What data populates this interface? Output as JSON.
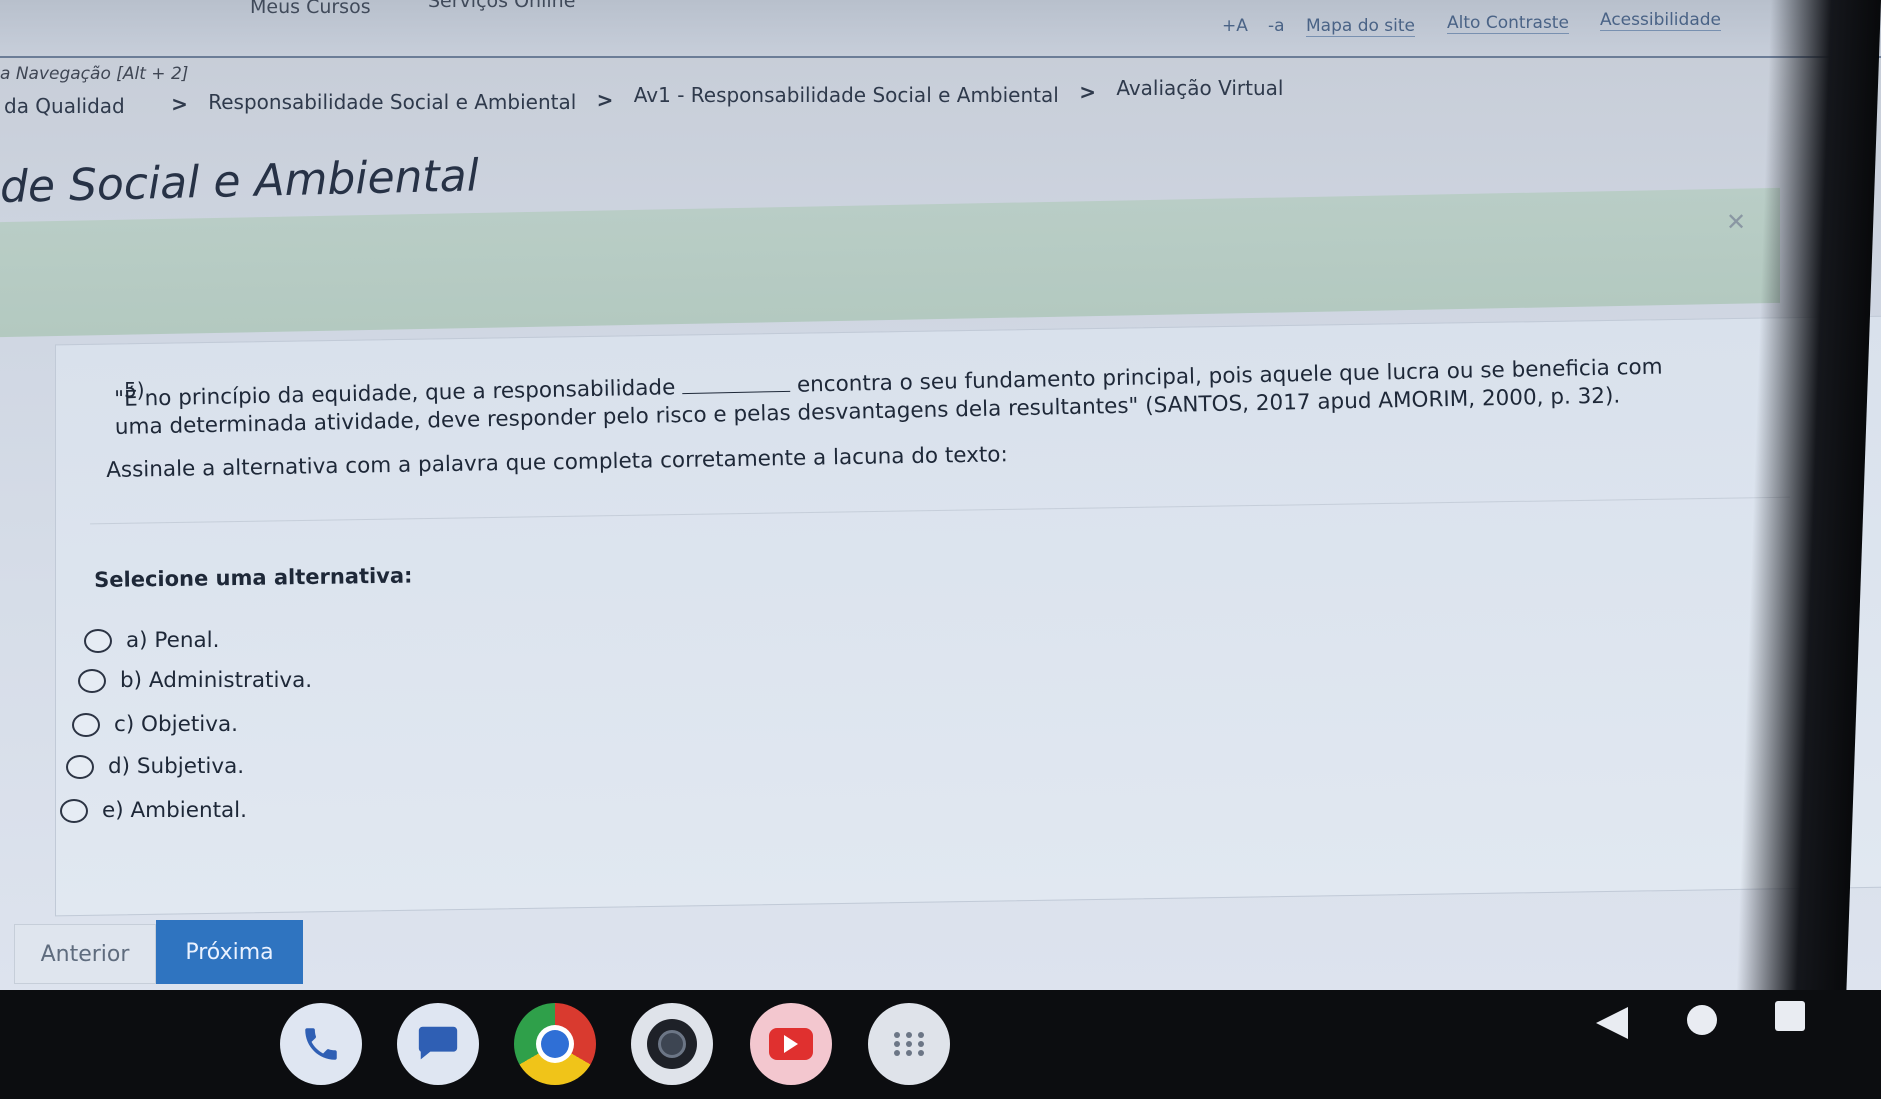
{
  "top_nav": {
    "meus_cursos": "Meus Cursos",
    "servicos_online": "Serviços Online"
  },
  "utility": {
    "increase_font": "+A",
    "decrease_font": "-a",
    "site_map": "Mapa do site",
    "high_contrast": "Alto Contraste",
    "accessibility": "Acessibilidade"
  },
  "skip_nav": "a Navegação [Alt + 2]",
  "breadcrumb": {
    "items": [
      "da Qualidad",
      "Responsabilidade Social e Ambiental",
      "Av1 - Responsabilidade Social e Ambiental",
      "Avaliação Virtual"
    ],
    "separator": ">"
  },
  "page_title": "de Social e Ambiental",
  "question": {
    "number": "5)",
    "text_before_blank": "\"É no princípio da equidade, que a responsabilidade ",
    "text_after_blank": " encontra o seu fundamento principal, pois aquele que lucra ou se beneficia com uma determinada atividade, deve responder pelo risco e pelas desvantagens dela resultantes\" (SANTOS, 2017 apud AMORIM, 2000, p. 32).",
    "instruction": "Assinale a alternativa com a palavra que completa corretamente a lacuna do texto:",
    "select_label": "Selecione uma alternativa:",
    "options": [
      "a) Penal.",
      "b) Administrativa.",
      "c) Objetiva.",
      "d) Subjetiva.",
      "e) Ambiental."
    ]
  },
  "buttons": {
    "previous": "Anterior",
    "next": "Próxima"
  },
  "colors": {
    "primary_button": "#2f74c0",
    "notice_bar": "#b5cac2",
    "link": "#4a6386"
  },
  "dock": {
    "apps": [
      "phone-icon",
      "messages-icon",
      "chrome-icon",
      "camera-icon",
      "youtube-icon",
      "app-drawer-icon"
    ]
  }
}
